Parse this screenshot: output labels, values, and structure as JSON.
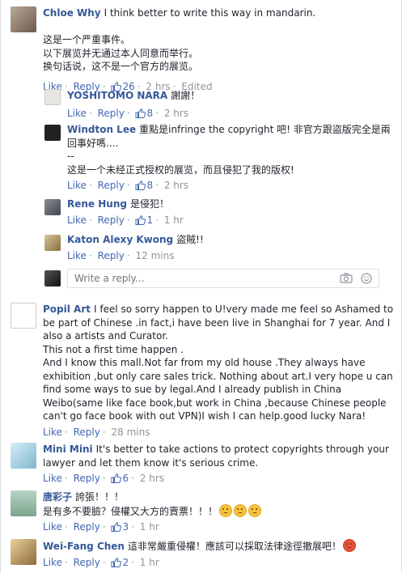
{
  "comments": [
    {
      "name": "Chloe Why",
      "text": "I think better to write this way in mandarin.\n\n这是一个严重事件。\n以下展览并无通过本人同意而举行。\n换句话说，这不是一个官方的展览。",
      "like": "Like",
      "reply": "Reply",
      "count": "26",
      "time": "2 hrs",
      "extra": "Edited"
    },
    {
      "name": "YOSHITOMO NARA",
      "text": "謝謝！",
      "like": "Like",
      "reply": "Reply",
      "count": "8",
      "time": "2 hrs"
    },
    {
      "name": "Windton Lee",
      "text": "重點是infringe the copyright 吧! 非官方跟盜版完全是兩回事好嗎....\n--\n这是一个未经正式授权的展览，而且侵犯了我的版权!",
      "like": "Like",
      "reply": "Reply",
      "count": "8",
      "time": "2 hrs"
    },
    {
      "name": "Rene Hung",
      "text": "是侵犯！",
      "like": "Like",
      "reply": "Reply",
      "count": "1",
      "time": "1 hr"
    },
    {
      "name": "Katon Alexy Kwong",
      "text": "盜賊!!",
      "like": "Like",
      "reply": "Reply",
      "time": "12 mins"
    },
    {
      "name": "Popil Art",
      "text": "I feel so sorry happen to U!very made me feel so Ashamed to be part of Chinese .in fact,i have been live in Shanghai for 7 year. And I also a artists and Curator.\nThis not a first time happen .\nAnd I know this mall.Not far from my old house .They always have exhibition ,but only care sales trick. Nothing about art.I very hope u can find some ways to sue by legal.And I already publish in China Weibo(same like face book,but work in China ,because Chinese people can't go face book with out VPN)I wish I can help.good lucky Nara!",
      "like": "Like",
      "reply": "Reply",
      "time": "28 mins"
    },
    {
      "name": "Mini Mini",
      "text": "It's better to take actions to protect copyrights through your lawyer and let them know it's serious crime.",
      "like": "Like",
      "reply": "Reply",
      "count": "6",
      "time": "2 hrs"
    },
    {
      "name": "唐彩子",
      "text": "誇張！！！\n是有多不要臉？侵權又大方的賣票！！！",
      "like": "Like",
      "reply": "Reply",
      "count": "3",
      "time": "1 hr"
    },
    {
      "name": "Wei-Fang Chen",
      "text": "這非常嚴重侵權！應該可以採取法律途徑撤展吧！",
      "like": "Like",
      "reply": "Reply",
      "count": "2",
      "time": "1 hr"
    }
  ],
  "reply_box": {
    "placeholder": "Write a reply..."
  },
  "icons": {
    "like": "thumbs-up-icon",
    "camera": "camera-icon",
    "emoji": "emoji-icon"
  },
  "colors": {
    "name": "#365899",
    "link": "#4267b2",
    "meta": "#90949c"
  }
}
